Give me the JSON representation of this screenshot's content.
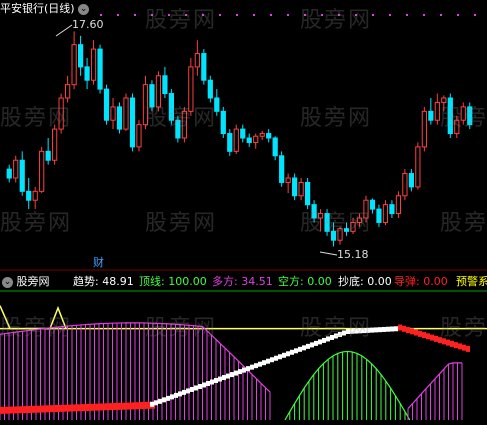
{
  "title": "平安银行(日线)",
  "indicator_name": "股旁网",
  "watermark": "股旁网",
  "annotations": {
    "high": "17.60",
    "low": "15.18",
    "cai": "财"
  },
  "indicator": {
    "trend_label": "趋势:",
    "trend_value": "48.91",
    "top_label": "顶线:",
    "top_value": "100.00",
    "long_label": "多方:",
    "long_value": "34.51",
    "short_label": "空方:",
    "short_value": "0.00",
    "bottom_label": "抄底:",
    "bottom_value": "0.00",
    "guide_label": "导弹:",
    "guide_value": "0.00",
    "warn_label": "预警系"
  },
  "colors": {
    "up": "#ff4040",
    "down": "#00e5ff",
    "bg": "#000000",
    "top_line": "#ffff66",
    "long": "#e040e0",
    "short": "#40ff40",
    "bottom": "#ffffff",
    "guide": "#ff2020",
    "warn": "#ffff00",
    "cai": "#40a0ff"
  },
  "chart_data": [
    {
      "type": "candlestick",
      "title": "平安银行(日线)",
      "ohlc": [
        [
          16.05,
          16.1,
          15.9,
          15.95
        ],
        [
          15.95,
          16.2,
          15.9,
          16.15
        ],
        [
          16.15,
          16.25,
          15.75,
          15.8
        ],
        [
          15.8,
          15.95,
          15.6,
          15.7
        ],
        [
          15.7,
          15.85,
          15.6,
          15.8
        ],
        [
          15.8,
          16.3,
          15.78,
          16.25
        ],
        [
          16.25,
          16.4,
          16.1,
          16.15
        ],
        [
          16.15,
          16.55,
          16.1,
          16.5
        ],
        [
          16.5,
          16.9,
          16.45,
          16.85
        ],
        [
          16.85,
          17.1,
          16.8,
          17.0
        ],
        [
          17.0,
          17.6,
          16.95,
          17.45
        ],
        [
          17.45,
          17.55,
          17.1,
          17.2
        ],
        [
          17.2,
          17.3,
          16.95,
          17.05
        ],
        [
          17.05,
          17.5,
          17.0,
          17.4
        ],
        [
          17.4,
          17.45,
          16.9,
          16.95
        ],
        [
          16.95,
          17.0,
          16.55,
          16.6
        ],
        [
          16.6,
          16.85,
          16.5,
          16.75
        ],
        [
          16.75,
          16.8,
          16.45,
          16.5
        ],
        [
          16.5,
          16.9,
          16.48,
          16.85
        ],
        [
          16.85,
          16.9,
          16.25,
          16.3
        ],
        [
          16.3,
          16.6,
          16.25,
          16.55
        ],
        [
          16.55,
          17.1,
          16.5,
          17.0
        ],
        [
          17.0,
          17.05,
          16.7,
          16.75
        ],
        [
          16.75,
          17.15,
          16.7,
          17.1
        ],
        [
          17.1,
          17.2,
          16.85,
          16.9
        ],
        [
          16.9,
          16.95,
          16.55,
          16.6
        ],
        [
          16.6,
          16.65,
          16.35,
          16.4
        ],
        [
          16.4,
          16.75,
          16.35,
          16.7
        ],
        [
          16.7,
          17.3,
          16.65,
          17.2
        ],
        [
          17.2,
          17.5,
          17.1,
          17.35
        ],
        [
          17.35,
          17.4,
          17.0,
          17.05
        ],
        [
          17.05,
          17.1,
          16.8,
          16.85
        ],
        [
          16.85,
          16.95,
          16.65,
          16.7
        ],
        [
          16.7,
          16.75,
          16.4,
          16.45
        ],
        [
          16.45,
          16.5,
          16.2,
          16.25
        ],
        [
          16.25,
          16.55,
          16.22,
          16.5
        ],
        [
          16.5,
          16.55,
          16.35,
          16.4
        ],
        [
          16.4,
          16.45,
          16.3,
          16.35
        ],
        [
          16.35,
          16.45,
          16.28,
          16.42
        ],
        [
          16.42,
          16.48,
          16.38,
          16.45
        ],
        [
          16.45,
          16.5,
          16.35,
          16.4
        ],
        [
          16.4,
          16.42,
          16.15,
          16.2
        ],
        [
          16.2,
          16.25,
          15.85,
          15.9
        ],
        [
          15.9,
          16.0,
          15.78,
          15.95
        ],
        [
          15.95,
          16.0,
          15.7,
          15.75
        ],
        [
          15.75,
          15.95,
          15.7,
          15.9
        ],
        [
          15.9,
          15.95,
          15.6,
          15.65
        ],
        [
          15.65,
          15.7,
          15.45,
          15.5
        ],
        [
          15.5,
          15.6,
          15.35,
          15.55
        ],
        [
          15.55,
          15.6,
          15.3,
          15.35
        ],
        [
          15.35,
          15.45,
          15.18,
          15.25
        ],
        [
          15.25,
          15.4,
          15.2,
          15.38
        ],
        [
          15.38,
          15.45,
          15.3,
          15.35
        ],
        [
          15.35,
          15.5,
          15.32,
          15.45
        ],
        [
          15.45,
          15.55,
          15.4,
          15.5
        ],
        [
          15.5,
          15.75,
          15.45,
          15.7
        ],
        [
          15.7,
          15.72,
          15.55,
          15.6
        ],
        [
          15.6,
          15.65,
          15.4,
          15.45
        ],
        [
          15.45,
          15.7,
          15.42,
          15.65
        ],
        [
          15.65,
          15.7,
          15.5,
          15.55
        ],
        [
          15.55,
          15.8,
          15.5,
          15.75
        ],
        [
          15.75,
          16.05,
          15.7,
          16.0
        ],
        [
          16.0,
          16.05,
          15.8,
          15.85
        ],
        [
          15.85,
          16.35,
          15.82,
          16.3
        ],
        [
          16.3,
          16.75,
          16.25,
          16.7
        ],
        [
          16.7,
          16.85,
          16.55,
          16.6
        ],
        [
          16.6,
          16.9,
          16.55,
          16.8
        ],
        [
          16.8,
          16.88,
          16.7,
          16.85
        ],
        [
          16.85,
          16.9,
          16.4,
          16.45
        ],
        [
          16.45,
          16.65,
          16.4,
          16.6
        ],
        [
          16.6,
          16.8,
          16.55,
          16.75
        ],
        [
          16.75,
          16.8,
          16.5,
          16.55
        ]
      ],
      "annotations": [
        {
          "text": "17.60",
          "type": "high"
        },
        {
          "text": "15.18",
          "type": "low"
        },
        {
          "text": "财",
          "type": "event"
        }
      ]
    },
    {
      "type": "indicator",
      "title": "股旁网",
      "series": [
        {
          "name": "顶线",
          "value": 100.0
        },
        {
          "name": "趋势",
          "value": 48.91
        },
        {
          "name": "多方",
          "value": 34.51
        },
        {
          "name": "空方",
          "value": 0.0
        },
        {
          "name": "抄底",
          "value": 0.0
        },
        {
          "name": "导弹",
          "value": 0.0
        }
      ],
      "ylim": [
        0,
        105
      ]
    }
  ]
}
